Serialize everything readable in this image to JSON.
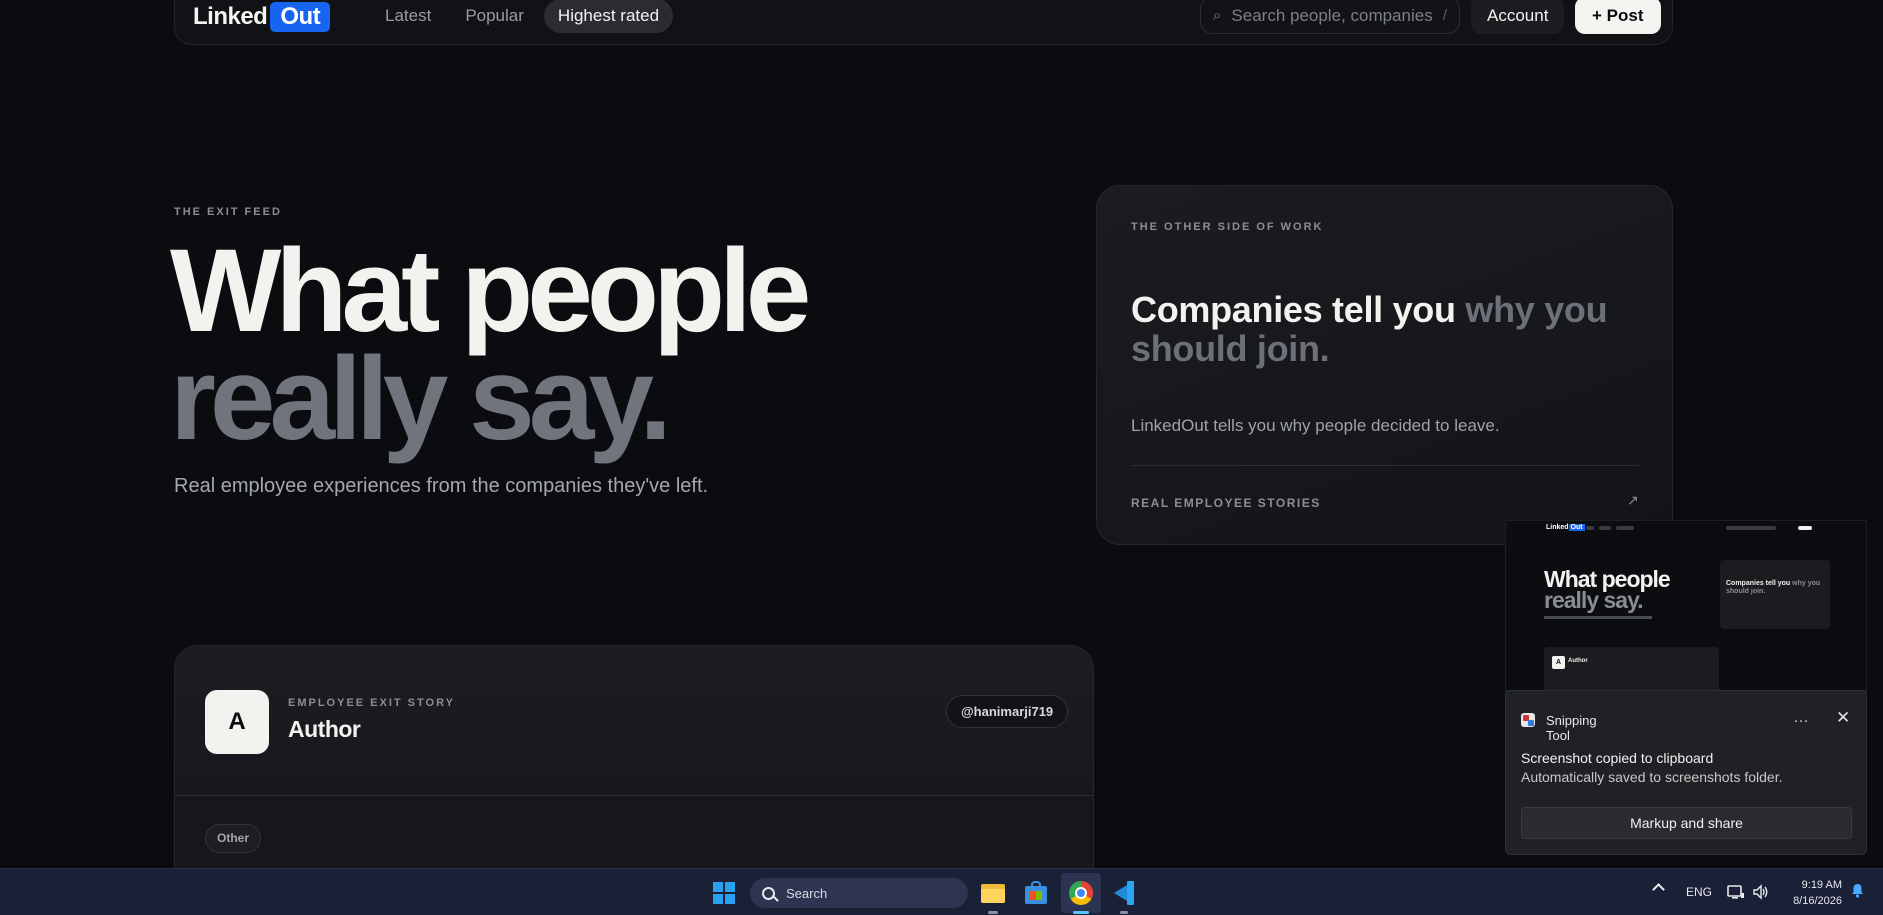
{
  "nav": {
    "logo_part1": "Linked",
    "logo_part2": "Out",
    "tabs": [
      {
        "label": "Latest"
      },
      {
        "label": "Popular"
      },
      {
        "label": "Highest rated"
      }
    ],
    "search_placeholder": "Search people, companies",
    "search_shortcut": "/",
    "account_label": "Account",
    "post_label": "+ Post",
    "logo_color": "#1664f0"
  },
  "hero": {
    "eyebrow": "THE EXIT FEED",
    "title_line1": "What people",
    "title_line2": "really say.",
    "subtitle": "Real employee experiences from the companies they've left."
  },
  "side_card": {
    "eyebrow": "THE OTHER SIDE OF WORK",
    "headline_white": "Companies tell you",
    "headline_grey": "why you should join.",
    "description": "LinkedOut tells you why people decided to leave.",
    "footer_label": "REAL EMPLOYEE STORIES",
    "footer_arrow": "↗"
  },
  "story": {
    "avatar_letter": "A",
    "label": "EMPLOYEE EXIT STORY",
    "author": "Author",
    "handle": "@hanimarji719",
    "tag": "Other"
  },
  "thumbnail": {
    "logo_part1": "Linked",
    "logo_part2": "Out",
    "title_line1": "What people",
    "title_line2": "really say.",
    "card_white": "Companies tell you",
    "card_grey": "why you should join.",
    "story_letter": "A",
    "story_author": "Author"
  },
  "toast": {
    "app_name": "Snipping Tool",
    "more_icon": "…",
    "close_icon": "✕",
    "title": "Screenshot copied to clipboard",
    "body": "Automatically saved to screenshots folder.",
    "button": "Markup and share"
  },
  "taskbar": {
    "search_label": "Search",
    "language": "ENG",
    "time": "9:19 AM",
    "date": "8/16/2026"
  }
}
